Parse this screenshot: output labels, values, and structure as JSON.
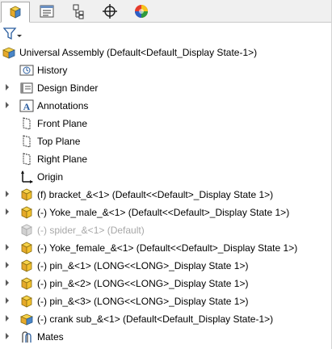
{
  "tabs": [
    {
      "name": "feature-manager",
      "icon": "feature-manager-icon",
      "active": true
    },
    {
      "name": "property-manager",
      "icon": "property-manager-icon",
      "active": false
    },
    {
      "name": "configuration-manager",
      "icon": "configuration-manager-icon",
      "active": false
    },
    {
      "name": "dimxpert-manager",
      "icon": "dimxpert-crosshair-icon",
      "active": false
    },
    {
      "name": "display-manager",
      "icon": "display-manager-icon",
      "active": false
    }
  ],
  "tree": {
    "root": {
      "label": "Universal Assembly  (Default<Default_Display State-1>)",
      "icon": "assembly-icon"
    },
    "items": [
      {
        "label": "History",
        "icon": "history-icon",
        "expandable": false
      },
      {
        "label": "Design Binder",
        "icon": "design-binder-icon",
        "expandable": true
      },
      {
        "label": "Annotations",
        "icon": "annotations-icon",
        "expandable": true
      },
      {
        "label": "Front Plane",
        "icon": "plane-icon",
        "expandable": false
      },
      {
        "label": "Top Plane",
        "icon": "plane-icon",
        "expandable": false
      },
      {
        "label": "Right Plane",
        "icon": "plane-icon",
        "expandable": false
      },
      {
        "label": "Origin",
        "icon": "origin-icon",
        "expandable": false
      },
      {
        "label": "(f) bracket_&<1> (Default<<Default>_Display State 1>)",
        "icon": "part-icon",
        "expandable": true
      },
      {
        "label": "(-) Yoke_male_&<1> (Default<<Default>_Display State 1>)",
        "icon": "part-icon",
        "expandable": true
      },
      {
        "label": "(-) spider_&<1> (Default)",
        "icon": "part-suppressed-icon",
        "expandable": false,
        "dimmed": true
      },
      {
        "label": "(-) Yoke_female_&<1> (Default<<Default>_Display State 1>)",
        "icon": "part-icon",
        "expandable": true
      },
      {
        "label": "(-) pin_&<1> (LONG<<LONG>_Display State 1>)",
        "icon": "part-icon",
        "expandable": true
      },
      {
        "label": "(-) pin_&<2> (LONG<<LONG>_Display State 1>)",
        "icon": "part-icon",
        "expandable": true
      },
      {
        "label": "(-) pin_&<3> (LONG<<LONG>_Display State 1>)",
        "icon": "part-icon",
        "expandable": true
      },
      {
        "label": "(-) crank sub_&<1> (Default<Default_Display State-1>)",
        "icon": "assembly-icon",
        "expandable": true
      },
      {
        "label": "Mates",
        "icon": "mates-icon",
        "expandable": true
      }
    ]
  },
  "filter": {
    "icon": "filter-icon"
  },
  "colors": {
    "part_yellow": "#f2c12e",
    "part_blue": "#4a86c8",
    "expander": "#5a5a5a",
    "dimmed": "#a8a8a8"
  }
}
